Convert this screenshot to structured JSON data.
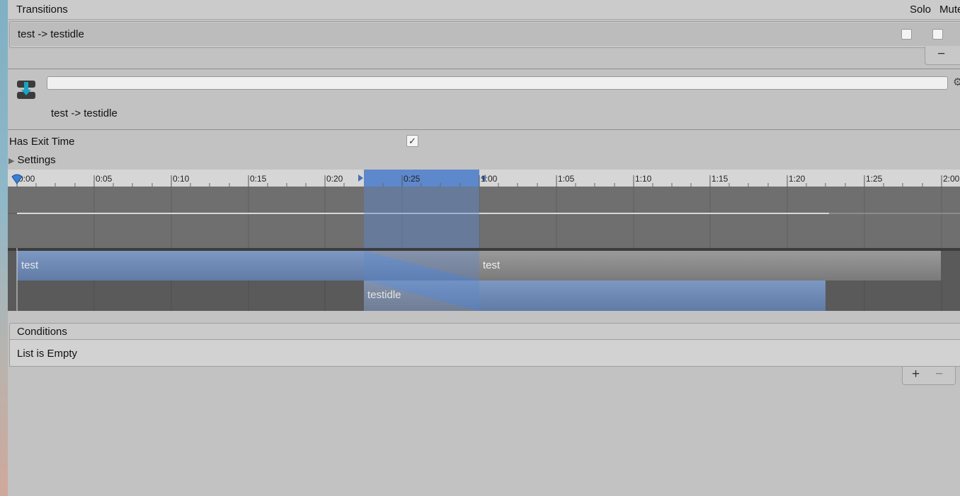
{
  "transitions": {
    "header": "Transitions",
    "solo_label": "Solo",
    "mute_label": "Mute",
    "rows": [
      {
        "label": "test -> testidle"
      }
    ],
    "remove_label": "−"
  },
  "transition": {
    "icon": "transition-icon",
    "name_value": "",
    "title": "test -> testidle",
    "settings_icon": "gear-icon",
    "has_exit_time_label": "Has Exit Time",
    "has_exit_time_checked": true,
    "check_glyph": "✓",
    "settings_label": "Settings"
  },
  "timeline": {
    "ticks": [
      "0:00",
      "0:05",
      "0:10",
      "0:15",
      "0:20",
      "0:25",
      "1:00",
      "1:05",
      "1:10",
      "1:15",
      "1:20",
      "1:25",
      "2:00"
    ],
    "clips": [
      {
        "label": "test"
      },
      {
        "label": "test"
      },
      {
        "label": "testidle"
      }
    ],
    "colors": {
      "highlight": "#5d88cc",
      "clip_blue": "#6b86b0",
      "clip_gray": "#8a8a8a"
    }
  },
  "conditions": {
    "header": "Conditions",
    "empty_text": "List is Empty",
    "add_label": "+",
    "remove_label": "−"
  }
}
